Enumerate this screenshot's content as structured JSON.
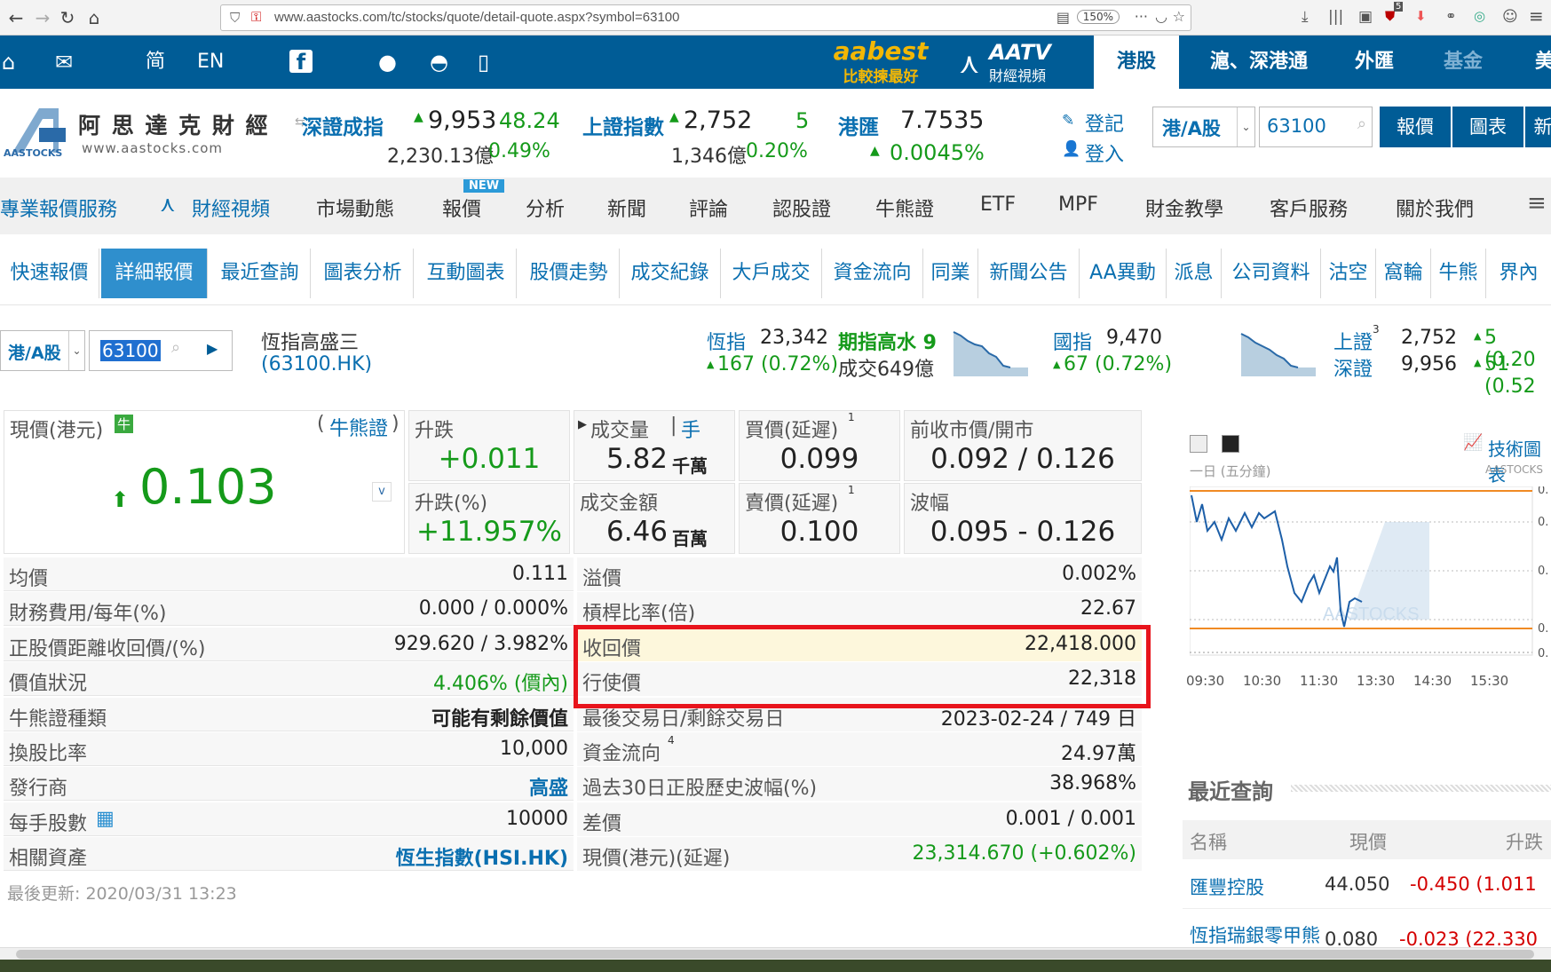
{
  "browser": {
    "url": "www.aastocks.com/tc/stocks/quote/detail-quote.aspx?symbol=63100",
    "zoom": "150%",
    "badge": "5"
  },
  "topbar": {
    "lang_simplified": "简",
    "lang_english": "EN",
    "promo1_top": "aabest",
    "promo1_bottom": "比較揀最好",
    "promo2_top": "AATV",
    "promo2_bottom": "財經視頻",
    "tabs": [
      "港股",
      "滬、深港通",
      "外匯",
      "基金",
      "美"
    ]
  },
  "header": {
    "logo_cn": "阿 思 達 克 財 經",
    "logo_url": "www.aastocks.com",
    "logo_mark": "AASTOCKS",
    "sz_name": "深證成指",
    "sz_value": "9,953",
    "sz_change": "48.24",
    "sz_turnover": "2,230.13億",
    "sz_pct": "0.49%",
    "sh_name": "上證指數",
    "sh_value": "2,752",
    "sh_change": "5",
    "sh_turnover": "1,346億",
    "sh_pct": "0.20%",
    "fx_name": "港匯",
    "fx_value": "7.7535",
    "fx_change": "0.0045%",
    "register": "登記",
    "login": "登入",
    "market_select": "港/A股",
    "search_value": "63100",
    "btn_quote": "報價",
    "btn_chart": "圖表",
    "btn_news": "新"
  },
  "mainnav": {
    "items": [
      "專業報價服務",
      "財經視頻",
      "市場動態",
      "報價",
      "分析",
      "新聞",
      "評論",
      "認股證",
      "牛熊證",
      "ETF",
      "MPF",
      "財金教學",
      "客戶服務",
      "關於我們"
    ],
    "new_badge": "NEW"
  },
  "subnav": {
    "items": [
      "快速報價",
      "詳細報價",
      "最近查詢",
      "圖表分析",
      "互動圖表",
      "股價走勢",
      "成交紀錄",
      "大戶成交",
      "資金流向",
      "同業",
      "新聞公告",
      "AA異動",
      "派息",
      "公司資料",
      "沽空",
      "窩輪",
      "牛熊",
      "界內"
    ]
  },
  "quotebar": {
    "market": "港/A股",
    "code": "63100",
    "name": "恆指高盛三",
    "ticker": "(63100.HK)",
    "hsi_label": "恆指",
    "hsi_value": "23,342",
    "hsi_change": "167 (0.72%)",
    "fut_label": "期指高水 9",
    "fut_turnover": "成交649億",
    "cei_label": "國指",
    "cei_value": "9,470",
    "cei_change": "67 (0.72%)",
    "sh_label": "上證",
    "sh_sup": "3",
    "sh_value": "2,752",
    "sh_change": "5 (0.20",
    "sz_label": "深證",
    "sz_value": "9,956",
    "sz_change": "51 (0.52"
  },
  "quote": {
    "price_label": "現價(港元)",
    "bull_tag": "牛",
    "cbbc_link": "牛熊證",
    "price": "0.103",
    "chg_label": "升跌",
    "chg": "+0.011",
    "chgpct_label": "升跌(%)",
    "chgpct": "+11.957%",
    "vol_label": "成交量",
    "vol_unit_label": "手",
    "vol": "5.82",
    "vol_unit": "千萬",
    "turnover_label": "成交金額",
    "turnover": "6.46",
    "turnover_unit": "百萬",
    "bid_label": "買價(延遲)",
    "bid": "0.099",
    "ask_label": "賣價(延遲)",
    "ask": "0.100",
    "sup1": "1",
    "prevopen_label": "前收市價/開市",
    "prevopen": "0.092 / 0.126",
    "range_label": "波幅",
    "range": "0.095 - 0.126",
    "dropdown": "v"
  },
  "details_left": [
    {
      "label": "均價",
      "value": "0.111"
    },
    {
      "label": "財務費用/每年(%)",
      "value": "0.000 / 0.000%"
    },
    {
      "label": "正股價距離收回價/(%)",
      "value": "929.620 / 3.982%"
    },
    {
      "label": "價值狀況",
      "value": "4.406% (價內)"
    },
    {
      "label": "牛熊證種類",
      "value": "可能有剩餘價值"
    },
    {
      "label": "換股比率",
      "value": "10,000"
    },
    {
      "label": "發行商",
      "value": "高盛"
    },
    {
      "label": "每手股數",
      "value": "10000"
    },
    {
      "label": "相關資產",
      "value": "恆生指數(HSI.HK)"
    }
  ],
  "details_right": [
    {
      "label": "溢價",
      "value": "0.002%"
    },
    {
      "label": "槓桿比率(倍)",
      "value": "22.67"
    },
    {
      "label": "收回價",
      "value": "22,418.000"
    },
    {
      "label": "行使價",
      "value": "22,318"
    },
    {
      "label": "最後交易日/剩餘交易日",
      "value": "2023-02-24 / 749 日"
    },
    {
      "label": "資金流向",
      "value": "24.97萬",
      "sup": "4"
    },
    {
      "label": "過去30日正股歷史波幅(%)",
      "value": "38.968%"
    },
    {
      "label": "差價",
      "value": "0.001 / 0.001"
    },
    {
      "label": "現價(港元)(延遲)",
      "value": "23,314.670 (+0.602%)"
    }
  ],
  "last_update": "最後更新: 2020/03/31 13:23",
  "chart_panel": {
    "title": "技術圖表",
    "period": "一日 (五分鐘)",
    "brand": "AASTOCKS",
    "watermark": "AASTOCKS",
    "x_ticks": [
      "09:30",
      "10:30",
      "11:30",
      "13:30",
      "14:30",
      "15:30"
    ],
    "y_ticks": [
      "0.",
      "0.",
      "0.",
      "0.",
      "0."
    ]
  },
  "recent": {
    "title": "最近查詢",
    "headers": [
      "名稱",
      "現價",
      "升跌"
    ],
    "rows": [
      {
        "name": "匯豐控股",
        "price": "44.050",
        "change": "-0.450 (1.011"
      },
      {
        "name": "恆指瑞銀零甲熊",
        "price": "0.080",
        "change": "-0.023 (22.330"
      }
    ]
  },
  "colors": {
    "brand_blue": "#005c96",
    "up_green": "#159a1a",
    "down_red": "#d40000",
    "highlight_red": "#e8141c",
    "link_blue": "#0a6fb0"
  }
}
